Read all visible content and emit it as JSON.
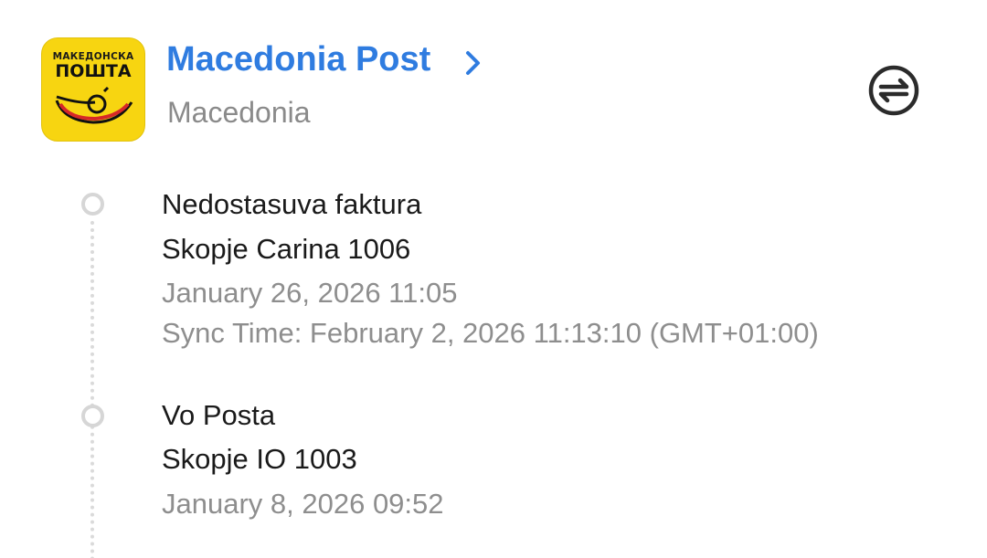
{
  "carrier": {
    "logo_text_top": "МАКЕДОНСКА",
    "logo_text_bottom": "ПОШТА",
    "name": "Macedonia Post",
    "country": "Macedonia",
    "accent_color": "#2f7ce0",
    "logo_color": "#f7d511"
  },
  "actions": {
    "chevron_icon": "chevron-right-icon",
    "swap_icon": "swap-arrows-icon"
  },
  "events": [
    {
      "status": "Nedostasuva faktura",
      "location": "Skopje Carina 1006",
      "time": "January 26, 2026 11:05",
      "sync_time": "Sync Time: February 2, 2026 11:13:10 (GMT+01:00)"
    },
    {
      "status": "Vo Posta",
      "location": "Skopje IO 1003",
      "time": "January 8, 2026 09:52"
    }
  ]
}
